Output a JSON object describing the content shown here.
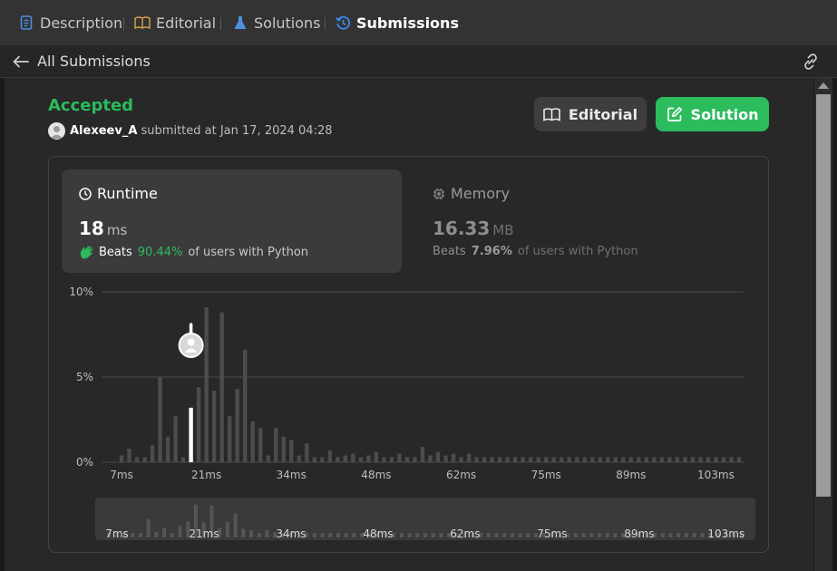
{
  "tabs": [
    {
      "label": "Description",
      "icon": "document-icon"
    },
    {
      "label": "Editorial",
      "icon": "book-icon"
    },
    {
      "label": "Solutions",
      "icon": "flask-icon"
    },
    {
      "label": "Submissions",
      "icon": "history-icon",
      "active": true
    }
  ],
  "subbar": {
    "back_label": "All Submissions"
  },
  "submission": {
    "status": "Accepted",
    "user": "Alexeev_A",
    "submitted_text": "submitted at Jan 17, 2024 04:28"
  },
  "buttons": {
    "editorial": "Editorial",
    "solution": "Solution"
  },
  "runtime": {
    "title": "Runtime",
    "value": "18",
    "unit": "ms",
    "beats_label": "Beats",
    "beats_pct": "90.44%",
    "beats_suffix": "of users with Python"
  },
  "memory": {
    "title": "Memory",
    "value": "16.33",
    "unit": "MB",
    "beats_label": "Beats",
    "beats_pct": "7.96%",
    "beats_suffix": "of users with Python"
  },
  "colors": {
    "accent_green": "#2cbb5d",
    "active_tab_icon": "#3a8ef6",
    "flask": "#4c8fdc",
    "book": "#d0a04e"
  },
  "chart_data": {
    "type": "bar",
    "title": "",
    "xlabel": "",
    "ylabel": "",
    "ylim": [
      0,
      10
    ],
    "y_ticks": [
      "10%",
      "5%",
      "0%"
    ],
    "x_ticks": [
      "7ms",
      "21ms",
      "34ms",
      "48ms",
      "62ms",
      "75ms",
      "89ms",
      "103ms"
    ],
    "highlight_bar_index": 9,
    "grid": true,
    "values": [
      0.4,
      0.8,
      0.3,
      0.3,
      1.0,
      5.0,
      1.5,
      2.7,
      0.3,
      3.2,
      4.4,
      9.1,
      4.2,
      8.8,
      2.7,
      4.3,
      6.6,
      2.4,
      2.0,
      0.4,
      2.0,
      1.5,
      1.3,
      0.4,
      1.1,
      0.3,
      0.3,
      0.7,
      0.3,
      0.4,
      0.5,
      0.3,
      0.4,
      0.6,
      0.3,
      0.3,
      0.5,
      0.3,
      0.3,
      0.9,
      0.4,
      0.6,
      0.4,
      0.5,
      0.3,
      0.5,
      0.3,
      0.3,
      0.3,
      0.3,
      0.3,
      0.3,
      0.3,
      0.3,
      0.3,
      0.3,
      0.3,
      0.3,
      0.3,
      0.3,
      0.3,
      0.3,
      0.3,
      0.3,
      0.3,
      0.3,
      0.3,
      0.3,
      0.3,
      0.3,
      0.3,
      0.3,
      0.3,
      0.3,
      0.3,
      0.3,
      0.3,
      0.3,
      0.3,
      0.3,
      0.3
    ]
  }
}
